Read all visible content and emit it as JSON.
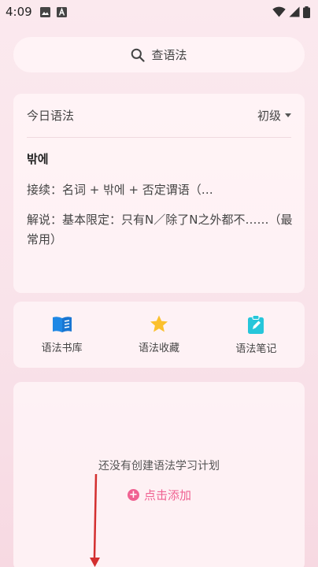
{
  "status_bar": {
    "time": "4:09"
  },
  "search": {
    "label": "查语法"
  },
  "today_grammar": {
    "title": "今日语法",
    "level": "初级",
    "word": "밖에",
    "connection": "接续：名词 + 밖에 + 否定谓语（…",
    "explanation": "解说：基本限定：只有N／除了N之外都不……（最常用）"
  },
  "tools": [
    {
      "label": "语法书库",
      "icon": "book-icon"
    },
    {
      "label": "语法收藏",
      "icon": "star-icon"
    },
    {
      "label": "语法笔记",
      "icon": "notepad-icon"
    }
  ],
  "study_plan": {
    "empty_text": "还没有创建语法学习计划",
    "add_label": "点击添加"
  },
  "colors": {
    "accent": "#f06292",
    "book": "#1e88e5",
    "star": "#fbc02d",
    "note": "#26c6da",
    "arrow": "#d32f2f"
  }
}
